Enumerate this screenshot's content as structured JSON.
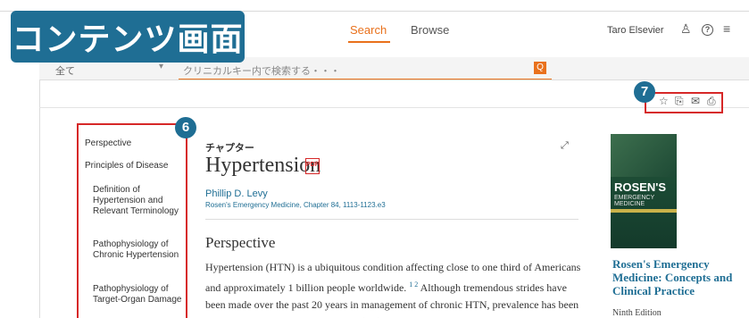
{
  "badge": {
    "title": "コンテンツ画面"
  },
  "header": {
    "nav_search": "Search",
    "nav_browse": "Browse",
    "user_name": "Taro Elsevier",
    "user_icon": "person-icon",
    "help_icon": "help-icon",
    "help_glyph": "?",
    "menu_icon": "hamburger-menu-icon",
    "menu_glyph": "≡",
    "user_glyph": "♙"
  },
  "search": {
    "scope": "全て",
    "caret": "▾",
    "placeholder": "クリニカルキー内で検索する・・・",
    "button_glyph": "Q"
  },
  "callouts": {
    "seven": "7",
    "six": "6"
  },
  "actions": {
    "star": "☆",
    "pdf": "⎘",
    "mail": "✉",
    "print": "⎙"
  },
  "toc": [
    "Perspective",
    "Principles of Disease",
    "Definition of Hypertension and Relevant Terminology",
    "Pathophysiology of Chronic Hypertension",
    "Pathophysiology of Target-Organ Damage"
  ],
  "article": {
    "kicker": "チャプター",
    "title": "Hypertension",
    "pdf_label": "PDF",
    "expand_glyph": "⤢",
    "author": "Phillip D. Levy",
    "citation": "Rosen's Emergency Medicine, Chapter 84, 1113-1123.e3",
    "section_heading": "Perspective",
    "body_1": "Hypertension (HTN) is a ubiquitous condition affecting close to one third of Americans and approximately 1 billion people worldwide.",
    "body_sup": "1 2",
    "body_2": " Although tremendous strides have been made over the past 20 years in management of chronic HTN, prevalence has been on a steady rise, and blood pressure (BP) is"
  },
  "book": {
    "cover_title": "ROSEN'S",
    "cover_subtitle": "EMERGENCY MEDICINE",
    "title": "Rosen's Emergency Medicine: Concepts and Clinical Practice",
    "edition": "Ninth Edition"
  },
  "colors": {
    "accent": "#e9711c",
    "badge": "#1f6e94",
    "highlight_box": "#d62828"
  }
}
